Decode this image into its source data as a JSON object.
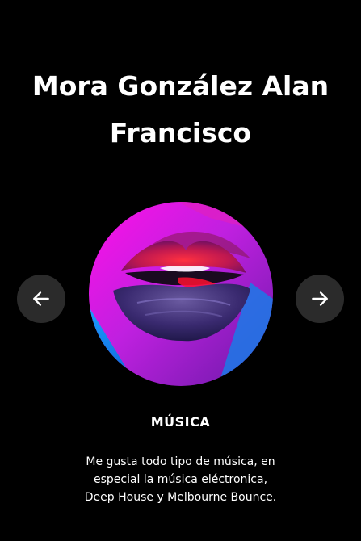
{
  "profile": {
    "name_line1": "Mora González Alan",
    "name_line2": "Francisco"
  },
  "carousel": {
    "prev_icon": "arrow-left-icon",
    "next_icon": "arrow-right-icon",
    "image_subject": "neon-lips-photo"
  },
  "item": {
    "title": "MÚSICA",
    "description_lines": [
      "Me gusta todo tipo de música, en",
      "especial la música eléctronica,",
      "Deep House y Melbourne Bounce."
    ]
  },
  "colors": {
    "background": "#000000",
    "text": "#ffffff",
    "nav_button": "#2b2b2b",
    "magenta": "#e010d8",
    "blue": "#1e6fe8",
    "lip_red": "#e0203a"
  }
}
